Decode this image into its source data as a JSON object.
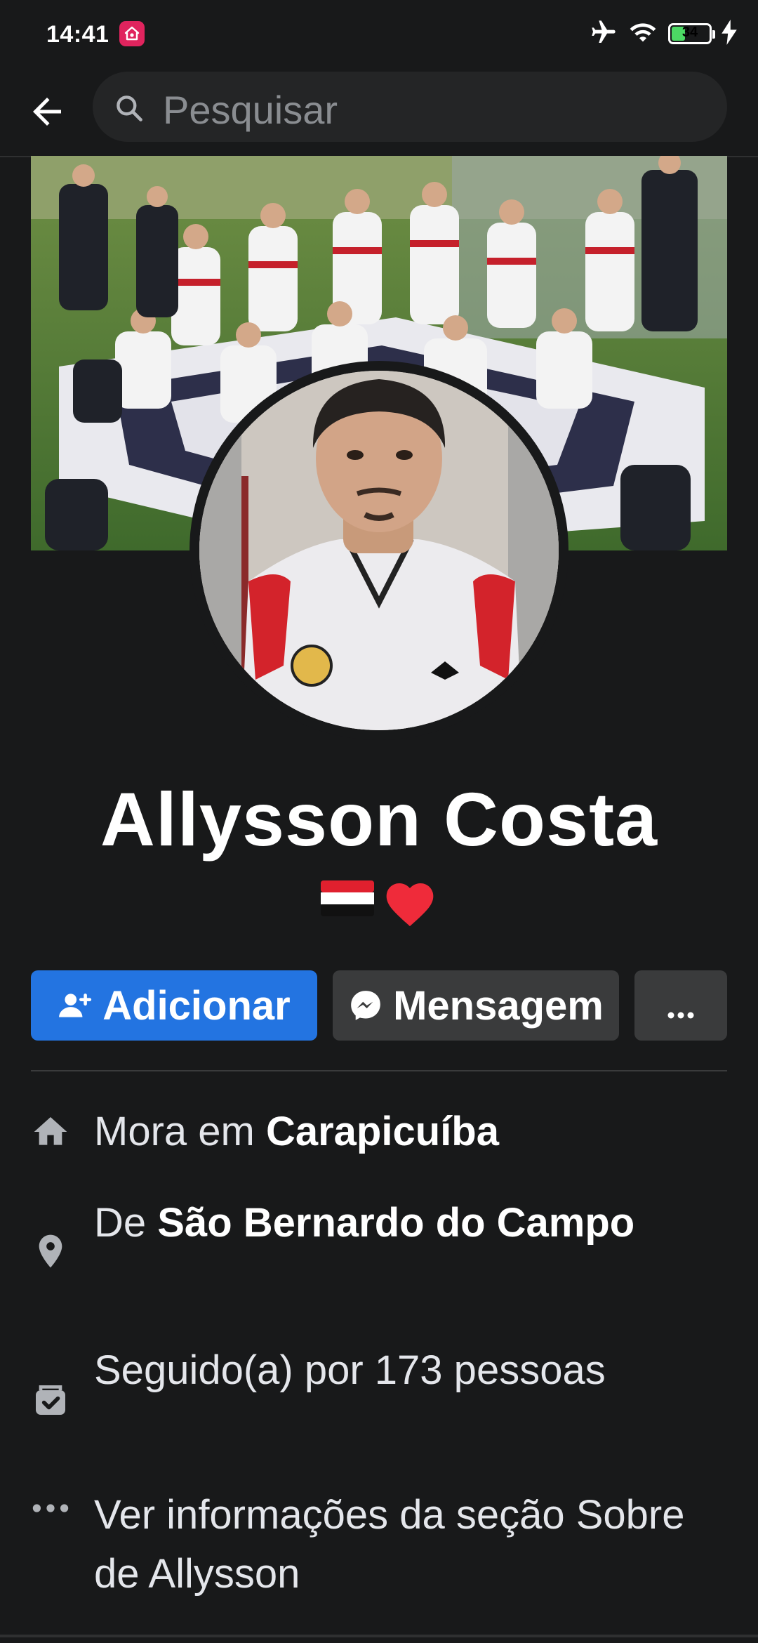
{
  "status_bar": {
    "time": "14:41",
    "battery_level": "34",
    "icons": [
      "app-notification-icon",
      "airplane-mode-icon",
      "wifi-icon",
      "battery-icon",
      "charging-bolt-icon"
    ]
  },
  "top_bar": {
    "search_placeholder": "Pesquisar"
  },
  "profile": {
    "name": "Allysson Costa",
    "bio_emoji": "🇾🇪❤️"
  },
  "actions": {
    "add_label": "Adicionar",
    "message_label": "Mensagem",
    "more_label": "···"
  },
  "details": {
    "lives_prefix": "Mora em ",
    "lives_city": "Carapicuíba",
    "from_prefix": "De ",
    "from_city": "São Bernardo do Campo",
    "followers_text": "Seguido(a) por 173 pessoas",
    "about_text": "Ver informações da seção Sobre de Allysson"
  },
  "colors": {
    "background": "#18191a",
    "primary_button": "#2374e1",
    "secondary_button": "#3a3b3c",
    "text": "#e4e6eb"
  }
}
